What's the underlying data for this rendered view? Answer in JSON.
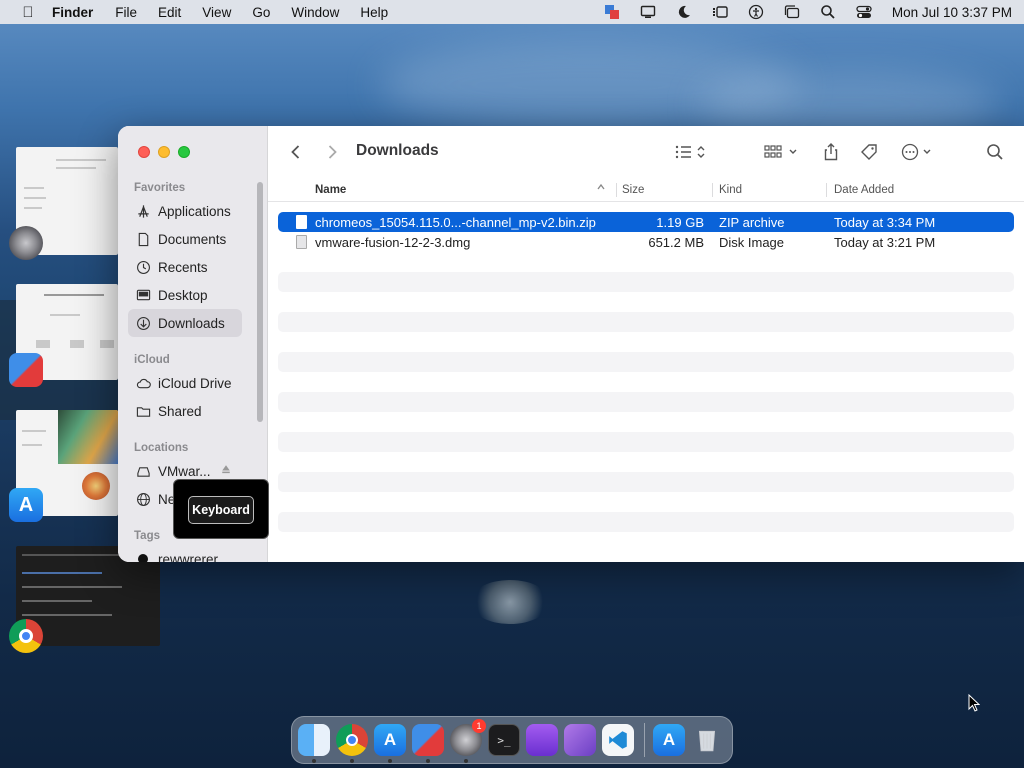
{
  "menubar": {
    "app_name": "Finder",
    "items": [
      "File",
      "Edit",
      "View",
      "Go",
      "Window",
      "Help"
    ],
    "clock": "Mon Jul 10  3:37 PM",
    "status_icons": [
      "vmware-icon",
      "display-icon",
      "moon-icon",
      "stage-manager-icon",
      "accessibility-icon",
      "window-icon",
      "search-icon",
      "control-center-icon"
    ]
  },
  "finder": {
    "title": "Downloads",
    "sidebar": {
      "favorites_header": "Favorites",
      "favorites": [
        "Applications",
        "Documents",
        "Recents",
        "Desktop",
        "Downloads"
      ],
      "icloud_header": "iCloud",
      "icloud": [
        "iCloud Drive",
        "Shared"
      ],
      "locations_header": "Locations",
      "locations": [
        "VMwar...",
        "Ne"
      ],
      "tags_header": "Tags",
      "tags": [
        "rewwrerer"
      ]
    },
    "columns": {
      "name": "Name",
      "size": "Size",
      "kind": "Kind",
      "date_added": "Date Added"
    },
    "files": [
      {
        "name": "chromeos_15054.115.0...-channel_mp-v2.bin.zip",
        "size": "1.19 GB",
        "kind": "ZIP archive",
        "date_added": "Today at 3:34 PM",
        "selected": true
      },
      {
        "name": "vmware-fusion-12-2-3.dmg",
        "size": "651.2 MB",
        "kind": "Disk Image",
        "date_added": "Today at 3:21 PM",
        "selected": false
      }
    ]
  },
  "tooltip": {
    "label": "Keyboard"
  },
  "dock": {
    "apps": [
      "finder-icon",
      "chrome-icon",
      "app-store-icon",
      "vmware-fusion-icon",
      "system-settings-icon",
      "terminal-icon",
      "podcasts-icon",
      "visual-studio-icon",
      "vscode-icon",
      "app-store-icon",
      "trash-icon"
    ],
    "settings_badge": "1"
  },
  "colors": {
    "selection": "#0a63d9",
    "sidebar_bg": "#e9e8ec",
    "close": "#fe5f57",
    "minimize": "#febc2e",
    "maximize": "#28c840"
  }
}
